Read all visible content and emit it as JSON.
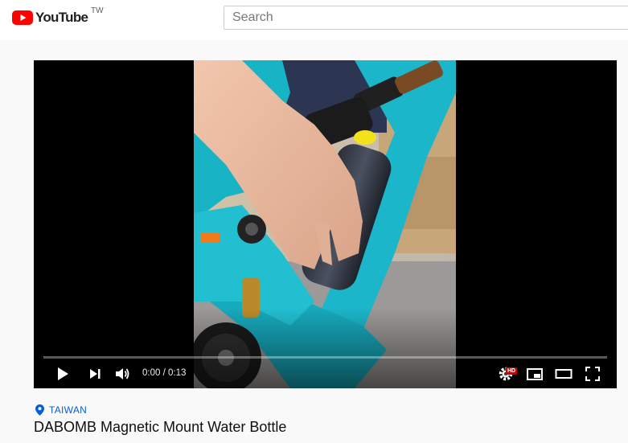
{
  "header": {
    "logo_text": "YouTube",
    "region": "TW",
    "search": {
      "placeholder": "Search",
      "value": ""
    }
  },
  "player": {
    "time_current": "0:00",
    "time_separator": " / ",
    "time_total": "0:13",
    "progress": 0.0,
    "hd_badge": "HD",
    "controls": [
      "play-icon",
      "next-icon",
      "volume-icon",
      "settings-icon",
      "miniplayer-icon",
      "theater-icon",
      "fullscreen-icon"
    ]
  },
  "video": {
    "location": "TAIWAN",
    "title": "DABOMB Magnetic Mount Water Bottle"
  },
  "colors": {
    "brand_red": "#ff0000",
    "link_blue": "#065fd4",
    "bike_teal": "#19b3c6"
  }
}
